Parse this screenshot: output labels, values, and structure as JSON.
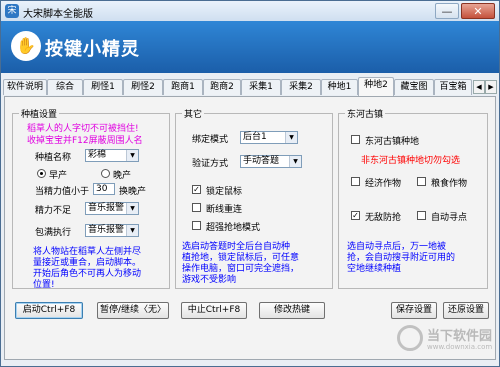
{
  "window": {
    "title": "大宋脚本全能版",
    "min_label": "—",
    "close_label": "✕"
  },
  "banner": {
    "title": "按键小精灵",
    "logo_glyph": "✋"
  },
  "tabs": [
    "软件说明",
    "综合",
    "刷怪1",
    "刷怪2",
    "跑商1",
    "跑商2",
    "采集1",
    "采集2",
    "种地1",
    "种地2",
    "藏宝图",
    "百宝箱"
  ],
  "active_tab": "种地2",
  "planting": {
    "title": "种植设置",
    "notice": [
      "稻草人的人字切不可被挡住!",
      "收掉宝宝并F12屏蔽周围人名"
    ],
    "crop_label": "种植名称",
    "crop_value": "彩棉",
    "radio_early": "早产",
    "radio_late": "晚产",
    "energy_label": "当精力值小于",
    "energy_value": "30",
    "energy_suffix": "换晚产",
    "low_energy_label": "精力不足",
    "low_energy_value": "音乐报警",
    "bag_full_label": "包满执行",
    "bag_full_value": "音乐报警",
    "tip": [
      "将人物站在稻草人左侧并尽",
      "量接近或重合，启动脚本。",
      "开始后角色不可再人为移动",
      "位置!"
    ]
  },
  "other": {
    "title": "其它",
    "bind_label": "绑定模式",
    "bind_value": "后台1",
    "verify_label": "验证方式",
    "verify_value": "手动答题",
    "lock_mouse": "锁定鼠标",
    "reconnect": "断线重连",
    "super_grab": "超强抢地模式",
    "tip": [
      "选启动答题时全后台自动种",
      "植抢地，锁定鼠标后，可任意",
      "操作电脑，窗口可完全遮挡，",
      "游戏不受影响"
    ]
  },
  "dongtong": {
    "title": "东河古镇",
    "auto_plant": "东河古镇种地",
    "warning": "非东河古镇种地切勿勾选",
    "economic": "经济作物",
    "grain": "粮食作物",
    "unlimited_defense": "无敌防抢",
    "auto_seek": "自动寻点",
    "tip": [
      "选自动寻点后，万一地被",
      "抢，会自动搜寻附近可用的",
      "空地继续种植"
    ]
  },
  "buttons": {
    "start": "启动Ctrl+F8",
    "pause": "暂停/继续〈无〉",
    "stop": "中止Ctrl+F8",
    "hotkey": "修改热键",
    "save": "保存设置",
    "restore": "还原设置"
  },
  "watermark": {
    "text": "当下软件园",
    "sub": "www.downxia.com"
  },
  "colors": {
    "pink": "#e000e0",
    "red": "#ff0000",
    "blue": "#0000ff",
    "banner": "#1b5ea9"
  }
}
